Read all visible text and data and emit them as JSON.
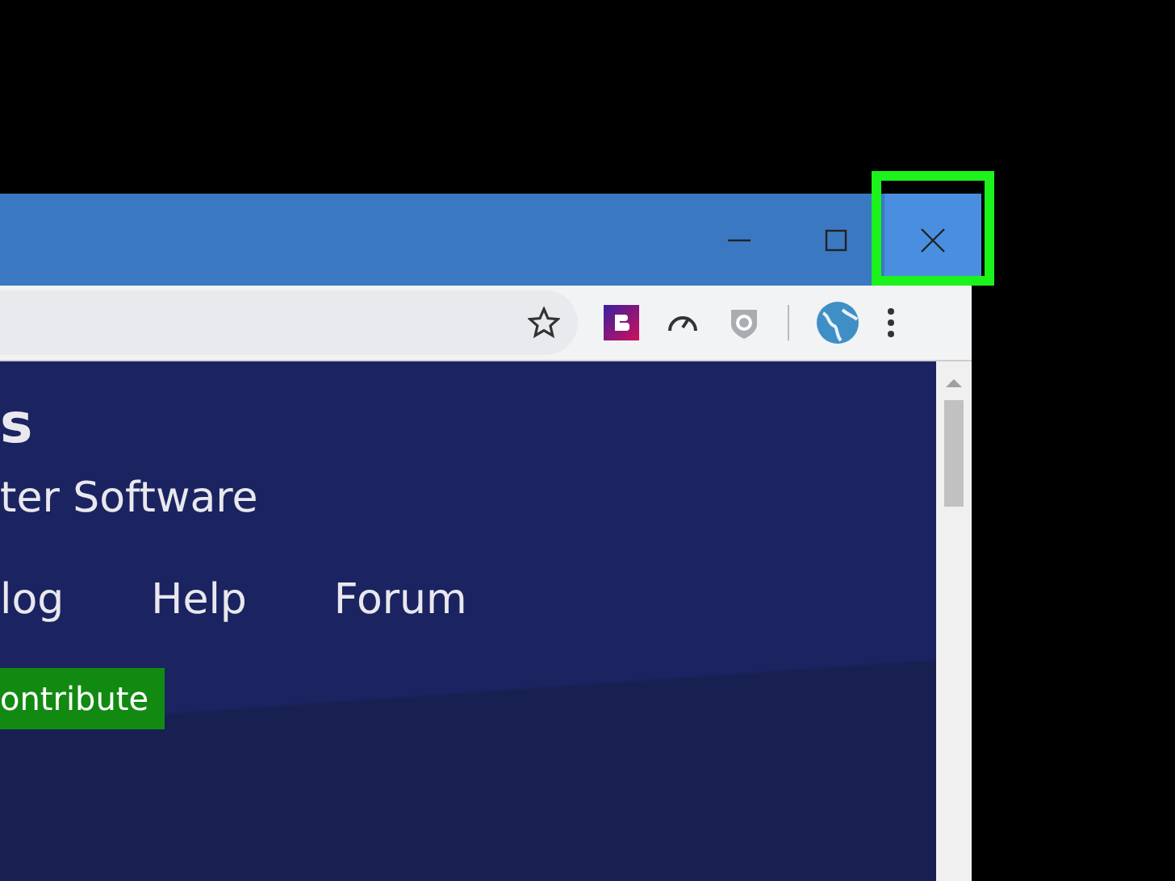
{
  "window": {
    "controls": [
      {
        "kind": "minimize",
        "highlighted": false
      },
      {
        "kind": "maximize",
        "highlighted": false
      },
      {
        "kind": "close",
        "highlighted": true
      }
    ]
  },
  "page": {
    "heading": "s",
    "tagline": "ter Software",
    "nav": [
      {
        "label": "log"
      },
      {
        "label": "Help"
      },
      {
        "label": "Forum"
      }
    ],
    "button": "ontribute"
  }
}
